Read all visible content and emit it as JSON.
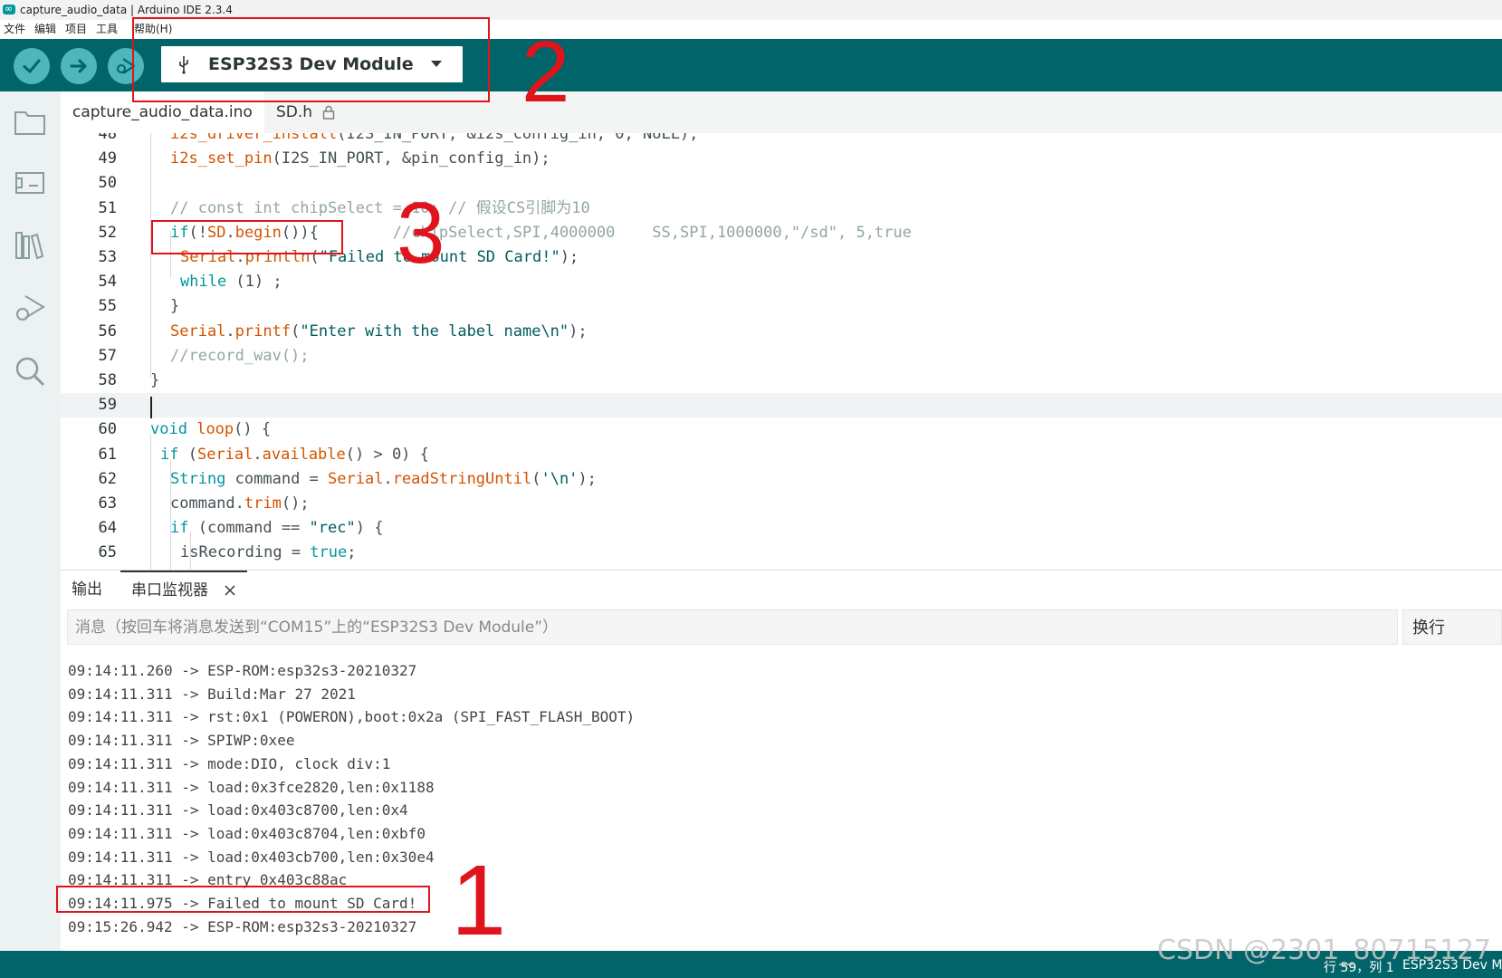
{
  "window": {
    "title": "capture_audio_data | Arduino IDE 2.3.4"
  },
  "menu": [
    "文件",
    "编辑",
    "项目",
    "工具",
    "帮助(H)"
  ],
  "toolbar": {
    "board": "ESP32S3 Dev Module"
  },
  "tabs": [
    {
      "label": "capture_audio_data.ino",
      "active": true
    },
    {
      "label": "SD.h",
      "locked": true
    }
  ],
  "editor": {
    "current_line": "59",
    "lines": [
      {
        "n": "48",
        "t": "    i2s_driver_install(I2S_IN_PORT, &i2s_config_in, 0, NULL);"
      },
      {
        "n": "49",
        "t": "    i2s_set_pin(I2S_IN_PORT, &pin_config_in);"
      },
      {
        "n": "50",
        "t": ""
      },
      {
        "n": "51",
        "t": "    // const int chipSelect = 10; // 假设CS引脚为10"
      },
      {
        "n": "52",
        "t": "    if(!SD.begin()){        //chipSelect,SPI,4000000    SS,SPI,1000000,\"/sd\", 5,true"
      },
      {
        "n": "53",
        "t": "      Serial.println(\"Failed to mount SD Card!\");"
      },
      {
        "n": "54",
        "t": "      while (1) ;"
      },
      {
        "n": "55",
        "t": "    }"
      },
      {
        "n": "56",
        "t": "    Serial.printf(\"Enter with the label name\\n\");"
      },
      {
        "n": "57",
        "t": "    //record_wav();"
      },
      {
        "n": "58",
        "t": "}"
      },
      {
        "n": "59",
        "t": ""
      },
      {
        "n": "60",
        "t": "void loop() {"
      },
      {
        "n": "61",
        "t": "  if (Serial.available() > 0) {"
      },
      {
        "n": "62",
        "t": "    String command = Serial.readStringUntil('\\n');"
      },
      {
        "n": "63",
        "t": "    command.trim();"
      },
      {
        "n": "64",
        "t": "    if (command == \"rec\") {"
      },
      {
        "n": "65",
        "t": "      isRecording = true;"
      }
    ]
  },
  "panel": {
    "tabs": [
      "输出",
      "串口监视器"
    ],
    "message_placeholder": "消息（按回车将消息发送到“COM15”上的“ESP32S3 Dev Module”）",
    "line_ending": "换行",
    "serial_lines": [
      "09:14:11.260 -> ESP-ROM:esp32s3-20210327",
      "09:14:11.311 -> Build:Mar 27 2021",
      "09:14:11.311 -> rst:0x1 (POWERON),boot:0x2a (SPI_FAST_FLASH_BOOT)",
      "09:14:11.311 -> SPIWP:0xee",
      "09:14:11.311 -> mode:DIO, clock div:1",
      "09:14:11.311 -> load:0x3fce2820,len:0x1188",
      "09:14:11.311 -> load:0x403c8700,len:0x4",
      "09:14:11.311 -> load:0x403c8704,len:0xbf0",
      "09:14:11.311 -> load:0x403cb700,len:0x30e4",
      "09:14:11.311 -> entry 0x403c88ac",
      "09:14:11.975 -> Failed to mount SD Card!",
      "09:15:26.942 -> ESP-ROM:esp32s3-20210327"
    ]
  },
  "statusbar": {
    "position": "行 59，列 1",
    "board": "ESP32S3 Dev M"
  },
  "watermark": "CSDN @2301_80715127",
  "annotations": [
    "1",
    "2",
    "3"
  ],
  "colors": {
    "teal": "#006468",
    "button": "#4db7bb",
    "annotation_red": "#e0141c"
  }
}
